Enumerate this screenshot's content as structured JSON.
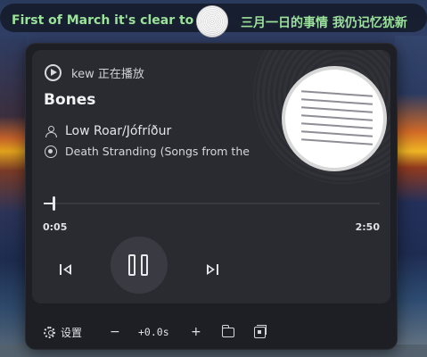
{
  "lyrics": {
    "current": "First of March it's clear to me",
    "translation": "三月一日的事情 我仍记忆犹新"
  },
  "player": {
    "status": "kew 正在播放",
    "title": "Bones",
    "artist": "Low Roar/Jófríður",
    "album": "Death Stranding (Songs from the",
    "progress_fraction": 0.03,
    "time_current": "0:05",
    "time_total": "2:50",
    "state": "playing"
  },
  "controls": {
    "previous_icon": "skip-previous-icon",
    "pause_icon": "pause-icon",
    "next_icon": "skip-next-icon"
  },
  "toolbar": {
    "settings_label": "设置",
    "decrease_label": "−",
    "offset": "+0.0s",
    "increase_label": "+",
    "folder_icon": "folder-icon",
    "cover_icon": "cover-art-icon"
  },
  "colors": {
    "lyric_text": "#9be29a",
    "panel_bg": "#1e1f24",
    "card_bg": "#2a2b31",
    "accent": "#e6e6ea"
  }
}
